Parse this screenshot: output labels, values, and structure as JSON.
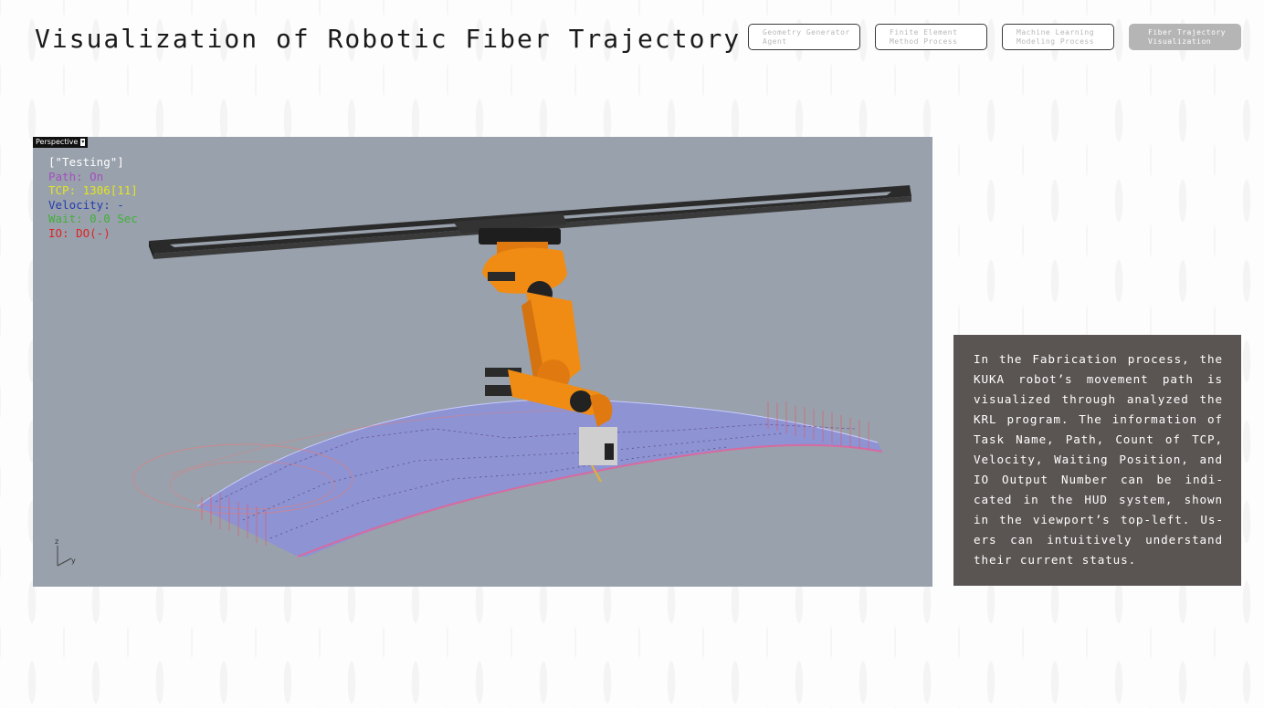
{
  "page": {
    "title": "Visualization of Robotic Fiber Trajectory"
  },
  "nav": {
    "tabs": [
      {
        "line1": "Geometry Generator",
        "line2": "Agent",
        "active": false
      },
      {
        "line1": "Finite Element",
        "line2": "Method Process",
        "active": false
      },
      {
        "line1": "Machine Learning",
        "line2": "Modeling Process",
        "active": false
      },
      {
        "line1": "Fiber Trajectory",
        "line2": "Visualization",
        "active": true
      }
    ]
  },
  "viewport": {
    "tab_label": "Perspective",
    "hud": {
      "task": "[\"Testing\"]",
      "path": "Path: On",
      "tcp": "TCP: 1306[11]",
      "velocity": "Velocity: -",
      "wait": "Wait: 0.0 Sec",
      "io": "IO: DO(-)"
    },
    "axis": {
      "z": "z",
      "y": "y"
    },
    "colors": {
      "background": "#99a1ac",
      "robot": "#f08c14",
      "gantry": "#2b2b2b",
      "surface": "#8a8fe0",
      "path": "#e05a6a"
    }
  },
  "description": {
    "text": "In the Fabrication process, the KUKA robot’s movement path is visualized through analyzed the KRL program. The information of Task Name, Path, Count of TCP, Velocity, Waiting Position, and IO Output Number can be indi­cated in the HUD system, shown in the viewport’s top-left. Us­ers can intuitively understand their current status."
  }
}
